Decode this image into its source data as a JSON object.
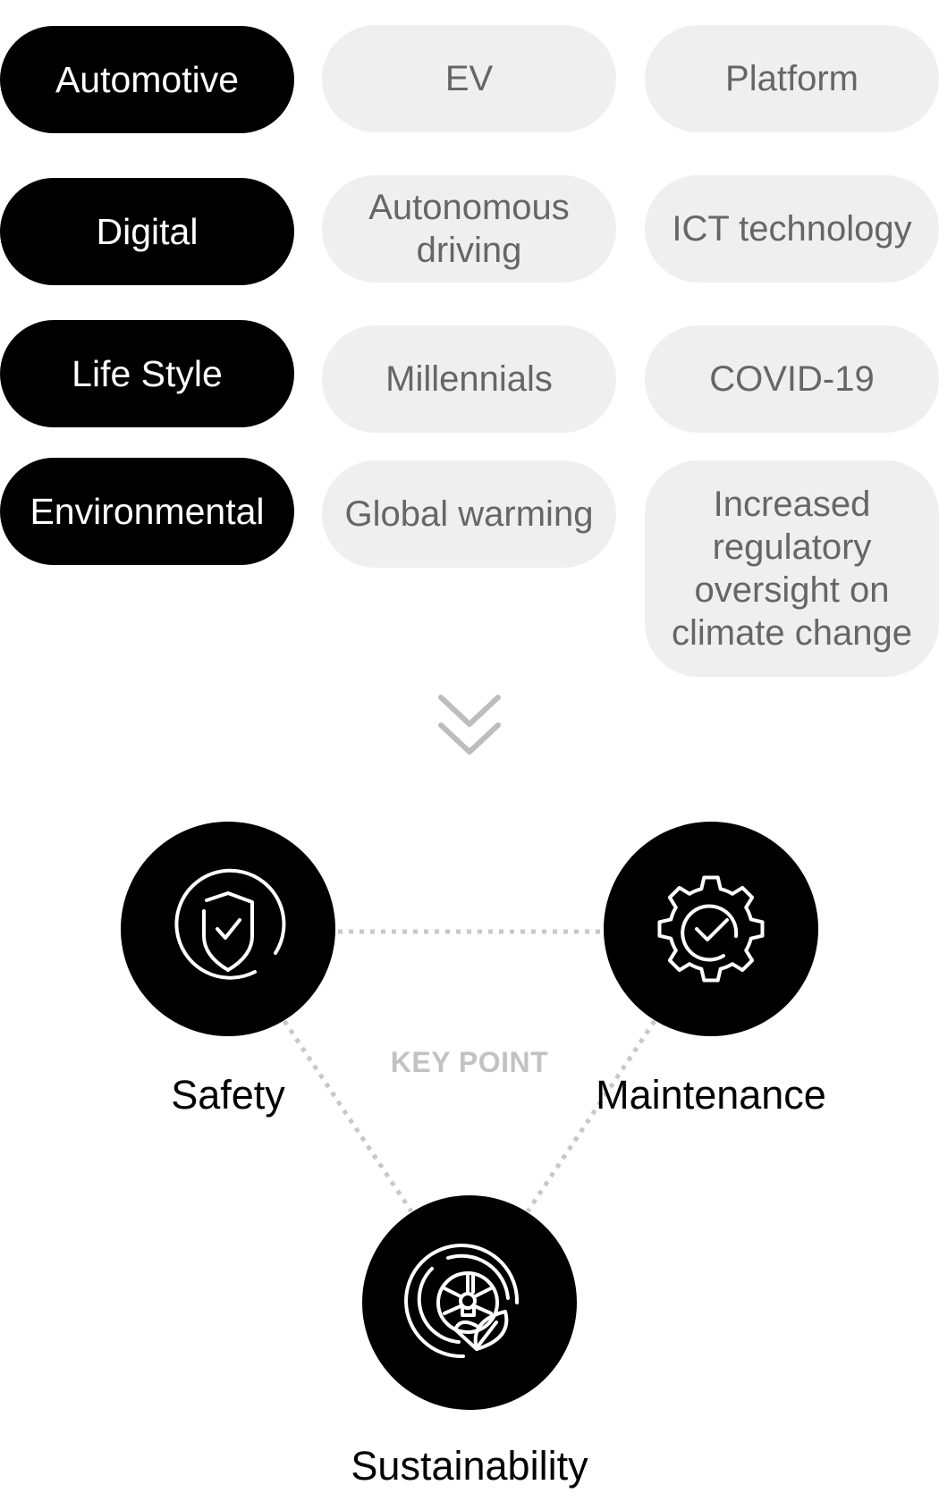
{
  "factors": [
    {
      "category": "Automotive",
      "items": [
        "EV",
        "Platform"
      ]
    },
    {
      "category": "Digital",
      "items": [
        "Autonomous driving",
        "ICT technology"
      ]
    },
    {
      "category": "Life Style",
      "items": [
        "Millennials",
        "COVID-19"
      ]
    },
    {
      "category": "Environmental",
      "items": [
        "Global warming",
        "Increased regulatory oversight on climate change"
      ]
    }
  ],
  "arrow_icon": "double-chevron-down-icon",
  "key_point": {
    "label": "KEY POINT",
    "nodes": [
      {
        "label": "Safety",
        "icon": "shield-check-icon"
      },
      {
        "label": "Maintenance",
        "icon": "gear-check-icon"
      },
      {
        "label": "Sustainability",
        "icon": "tire-leaf-icon"
      }
    ]
  },
  "colors": {
    "category_bg": "#000000",
    "category_text": "#ffffff",
    "item_bg": "#efefef",
    "item_text": "#666666",
    "connector": "#c8c8c8",
    "key_point_text": "#c2c2c2"
  }
}
